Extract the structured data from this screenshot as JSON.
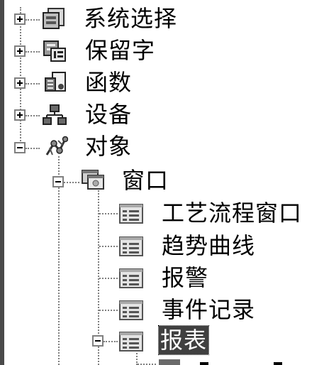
{
  "tree": {
    "nodes": [
      {
        "label": "系统选择",
        "expander": "+",
        "icon": "system-select-icon"
      },
      {
        "label": "保留字",
        "expander": "+",
        "icon": "reserved-words-icon"
      },
      {
        "label": "函数",
        "expander": "+",
        "icon": "functions-icon"
      },
      {
        "label": "设备",
        "expander": "+",
        "icon": "devices-icon"
      },
      {
        "label": "对象",
        "expander": "-",
        "icon": "objects-icon"
      },
      {
        "label": "窗口",
        "expander": "-",
        "icon": "window-folder-icon"
      },
      {
        "label": "工艺流程窗口",
        "icon": "form-window-icon"
      },
      {
        "label": "趋势曲线",
        "icon": "form-window-icon"
      },
      {
        "label": "报警",
        "icon": "form-window-icon"
      },
      {
        "label": "事件记录",
        "icon": "form-window-icon"
      },
      {
        "label": "报表",
        "expander": "-",
        "icon": "form-window-icon",
        "selected": true
      }
    ]
  },
  "colors": {
    "selection_bg": "#404040",
    "connector": "#7f7f7f"
  }
}
